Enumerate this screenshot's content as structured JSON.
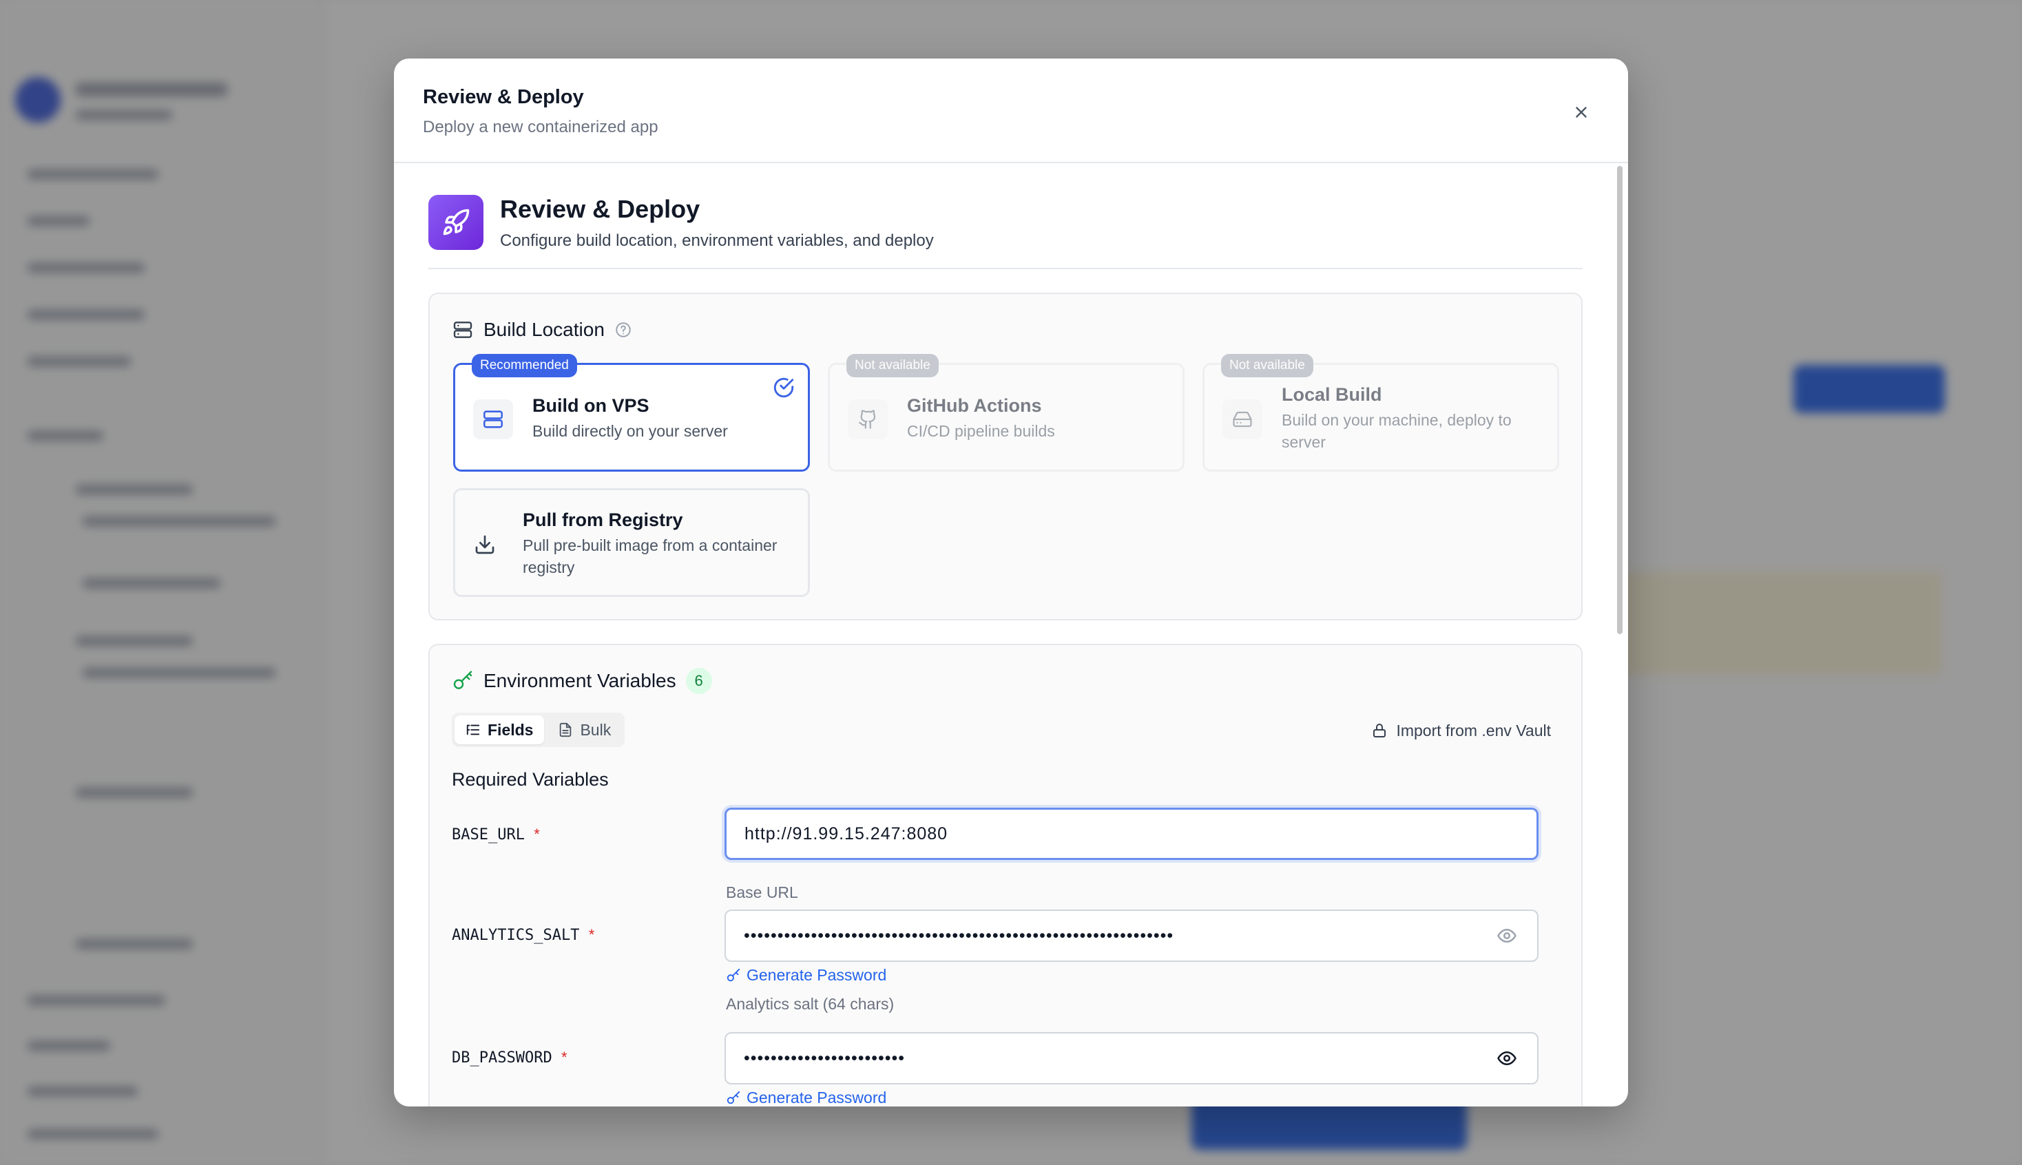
{
  "modal": {
    "title": "Review & Deploy",
    "subtitle": "Deploy a new containerized app"
  },
  "hero": {
    "title": "Review & Deploy",
    "subtitle": "Configure build location, environment variables, and deploy",
    "icon": "rocket-icon"
  },
  "build_location": {
    "title": "Build Location",
    "options": [
      {
        "badge": "Recommended",
        "title": "Build on VPS",
        "subtitle": "Build directly on your server",
        "icon": "server-icon",
        "selected": true,
        "available": true
      },
      {
        "badge": "Not available",
        "title": "GitHub Actions",
        "subtitle": "CI/CD pipeline builds",
        "icon": "github-icon",
        "selected": false,
        "available": false
      },
      {
        "badge": "Not available",
        "title": "Local Build",
        "subtitle": "Build on your machine, deploy to server",
        "icon": "hard-drive-icon",
        "selected": false,
        "available": false
      },
      {
        "badge": "",
        "title": "Pull from Registry",
        "subtitle": "Pull pre-built image from a container registry",
        "icon": "download-icon",
        "selected": false,
        "available": true
      }
    ]
  },
  "env": {
    "title": "Environment Variables",
    "count": "6",
    "tabs": [
      "Fields",
      "Bulk"
    ],
    "active_tab": "Fields",
    "import_label": "Import from .env Vault",
    "required_title": "Required Variables",
    "vars": [
      {
        "name": "BASE_URL",
        "required": "*",
        "value": "http://91.99.15.247:8080",
        "hint": "Base URL",
        "masked": false
      },
      {
        "name": "ANALYTICS_SALT",
        "required": "*",
        "value": "••••••••••••••••••••••••••••••••••••••••••••••••••••••••••••••••",
        "generate": "Generate Password",
        "hint": "Analytics salt (64 chars)",
        "masked": true
      },
      {
        "name": "DB_PASSWORD",
        "required": "*",
        "value": "••••••••••••••••••••••••",
        "generate": "Generate Password",
        "masked": true
      }
    ]
  },
  "colors": {
    "accent": "#3b63e6",
    "hero_gradient_start": "#8b5cf6",
    "hero_gradient_end": "#6d28d9",
    "count_badge_bg": "#dcfce7",
    "required_star": "#dc2626",
    "link": "#2563eb"
  }
}
